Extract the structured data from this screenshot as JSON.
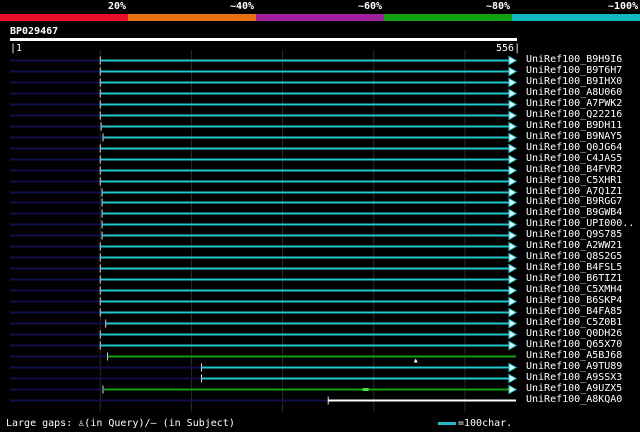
{
  "legend": {
    "labels": [
      "20%",
      "~40%",
      "~60%",
      "~80%",
      "~100%"
    ],
    "colors": [
      "#e8102a",
      "#e87010",
      "#a020a0",
      "#10a010",
      "#10b8c0"
    ]
  },
  "query": {
    "id": "BP029467",
    "start": "1",
    "end": "556",
    "length": 556
  },
  "gridlines": [
    100,
    200,
    300,
    400,
    500
  ],
  "colors": {
    "cyan": "#22c8cc",
    "green": "#10a010",
    "navy": "#10104a",
    "white": "#ffffff"
  },
  "hits": [
    {
      "label": "UniRef100_B9H9I6",
      "start": 100,
      "end": 556,
      "color": "cyan",
      "arrow": true
    },
    {
      "label": "UniRef100_B9T6H7",
      "start": 100,
      "end": 556,
      "color": "cyan",
      "arrow": true
    },
    {
      "label": "UniRef100_B9IHX0",
      "start": 100,
      "end": 556,
      "color": "cyan",
      "arrow": true
    },
    {
      "label": "UniRef100_A8U060",
      "start": 100,
      "end": 556,
      "color": "cyan",
      "arrow": true
    },
    {
      "label": "UniRef100_A7PWK2",
      "start": 100,
      "end": 556,
      "color": "cyan",
      "arrow": true
    },
    {
      "label": "UniRef100_Q22216",
      "start": 100,
      "end": 556,
      "color": "cyan",
      "arrow": true
    },
    {
      "label": "UniRef100_B9DH11",
      "start": 101,
      "end": 556,
      "color": "cyan",
      "arrow": true
    },
    {
      "label": "UniRef100_B9NAY5",
      "start": 103,
      "end": 556,
      "color": "cyan",
      "arrow": true
    },
    {
      "label": "UniRef100_Q0JG64",
      "start": 100,
      "end": 556,
      "color": "cyan",
      "arrow": true
    },
    {
      "label": "UniRef100_C4JAS5",
      "start": 100,
      "end": 556,
      "color": "cyan",
      "arrow": true
    },
    {
      "label": "UniRef100_B4FVR2",
      "start": 100,
      "end": 556,
      "color": "cyan",
      "arrow": true
    },
    {
      "label": "UniRef100_C5XHR1",
      "start": 100,
      "end": 556,
      "color": "cyan",
      "arrow": true
    },
    {
      "label": "UniRef100_A7Q1Z1",
      "start": 102,
      "end": 556,
      "color": "cyan",
      "arrow": true
    },
    {
      "label": "UniRef100_B9RGG7",
      "start": 102,
      "end": 556,
      "color": "cyan",
      "arrow": true
    },
    {
      "label": "UniRef100_B9GWB4",
      "start": 102,
      "end": 556,
      "color": "cyan",
      "arrow": true
    },
    {
      "label": "UniRef100_UPI000..",
      "start": 102,
      "end": 556,
      "color": "cyan",
      "arrow": true
    },
    {
      "label": "UniRef100_Q9S785",
      "start": 102,
      "end": 556,
      "color": "cyan",
      "arrow": true
    },
    {
      "label": "UniRef100_A2WW21",
      "start": 100,
      "end": 556,
      "color": "cyan",
      "arrow": true
    },
    {
      "label": "UniRef100_Q8S2G5",
      "start": 100,
      "end": 556,
      "color": "cyan",
      "arrow": true
    },
    {
      "label": "UniRef100_B4FSL5",
      "start": 100,
      "end": 556,
      "color": "cyan",
      "arrow": true
    },
    {
      "label": "UniRef100_B6TIZ1",
      "start": 100,
      "end": 556,
      "color": "cyan",
      "arrow": true
    },
    {
      "label": "UniRef100_C5XMH4",
      "start": 100,
      "end": 556,
      "color": "cyan",
      "arrow": true
    },
    {
      "label": "UniRef100_B6SKP4",
      "start": 100,
      "end": 556,
      "color": "cyan",
      "arrow": true
    },
    {
      "label": "UniRef100_B4FA85",
      "start": 100,
      "end": 556,
      "color": "cyan",
      "arrow": true
    },
    {
      "label": "UniRef100_C5Z0B1",
      "start": 106,
      "end": 556,
      "color": "cyan",
      "arrow": true
    },
    {
      "label": "UniRef100_Q0DH26",
      "start": 100,
      "end": 556,
      "color": "cyan",
      "arrow": true
    },
    {
      "label": "UniRef100_Q65X70",
      "start": 100,
      "end": 556,
      "color": "cyan",
      "arrow": true
    },
    {
      "label": "UniRef100_A5BJ68",
      "start": 108,
      "end": 556,
      "color": "green",
      "arrow": false,
      "query_gap": 446
    },
    {
      "label": "UniRef100_A9TU89",
      "start": 211,
      "end": 556,
      "color": "cyan",
      "arrow": true
    },
    {
      "label": "UniRef100_A9SSX3",
      "start": 211,
      "end": 556,
      "color": "cyan",
      "arrow": true
    },
    {
      "label": "UniRef100_A9UZX5",
      "start": 103,
      "end": 556,
      "color": "green",
      "arrow": true,
      "subject_gap": 391
    },
    {
      "label": "UniRef100_A8KQA0",
      "start": 350,
      "end": 556,
      "color": "white",
      "arrow": false
    }
  ],
  "footer": {
    "large_gaps_label": "Large gaps:",
    "query_gap_glyph": "♙",
    "in_query": "(in Query)/",
    "subject_gap_glyph": "–",
    "in_subject": "(in Subject)",
    "scale_label": "=100char."
  }
}
